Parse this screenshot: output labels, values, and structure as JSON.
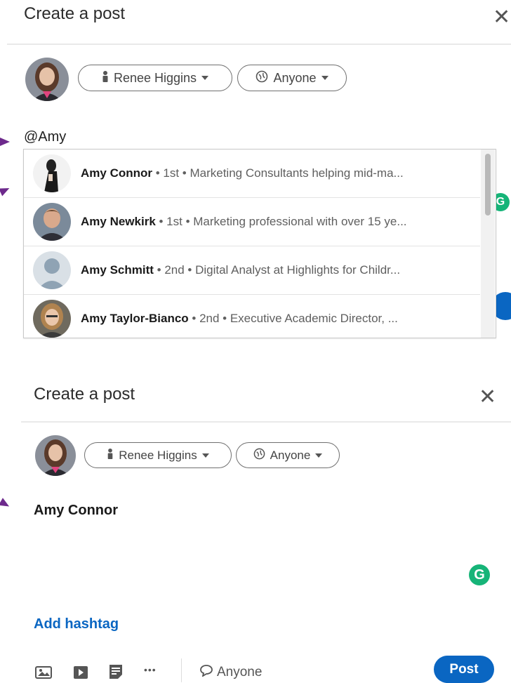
{
  "top": {
    "title": "Create a post",
    "close_glyph": "✕",
    "author_label": "Renee Higgins",
    "visibility_label": "Anyone",
    "mention_text": "@Amy",
    "suggestions": [
      {
        "name": "Amy Connor",
        "detail": " • 1st • Marketing Consultants helping mid-ma..."
      },
      {
        "name": "Amy Newkirk",
        "detail": " • 1st • Marketing professional with over 15 ye..."
      },
      {
        "name": "Amy Schmitt",
        "detail": " • 2nd • Digital Analyst at Highlights for Childr..."
      },
      {
        "name": "Amy Taylor-Bianco",
        "detail": " • 2nd • Executive Academic Director, ..."
      }
    ]
  },
  "bottom": {
    "title": "Create a post",
    "close_glyph": "✕",
    "author_label": "Renee Higgins",
    "visibility_label": "Anyone",
    "mention_name": "Amy Connor",
    "grammarly_glyph": "G",
    "add_hashtag": "Add hashtag",
    "more_glyph": "•••",
    "comment_visibility": "Anyone",
    "post_label": "Post"
  },
  "colors": {
    "accent": "#0a66c2",
    "arrow": "#6d2a8c",
    "grammarly": "#16b478"
  },
  "icons": [
    "person-icon",
    "globe-icon",
    "caret-down-icon",
    "close-icon",
    "photo-icon",
    "video-icon",
    "document-icon",
    "more-icon",
    "comment-icon",
    "grammarly-icon"
  ]
}
